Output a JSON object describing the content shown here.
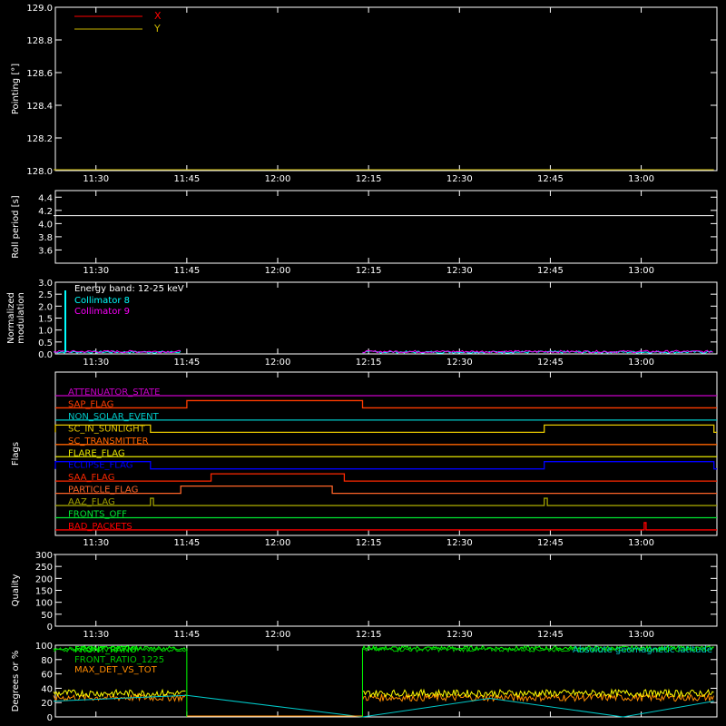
{
  "time_ticks": [
    "11:30",
    "11:45",
    "12:00",
    "12:15",
    "12:30",
    "12:45",
    "13:00"
  ],
  "chart_data": [
    {
      "type": "line",
      "panel": "pointing",
      "ylabel": "Pointing [°]",
      "ylim": [
        128.0,
        129.0
      ],
      "yticks": [
        "128.0",
        "128.2",
        "128.4",
        "128.6",
        "128.8",
        "129.0"
      ],
      "series": [
        {
          "name": "X",
          "color": "#ff0000",
          "values": []
        },
        {
          "name": "Y",
          "color": "#c8b400",
          "x": [
            "11:23",
            "13:12"
          ],
          "values": [
            128.0,
            128.0
          ]
        }
      ]
    },
    {
      "type": "line",
      "panel": "roll_period",
      "ylabel": "Roll period [s]",
      "ylim": [
        3.4,
        4.5
      ],
      "yticks": [
        "3.6",
        "3.8",
        "4.0",
        "4.2",
        "4.4"
      ],
      "series": [
        {
          "color": "#ffffff",
          "x": [
            "11:23",
            "13:12"
          ],
          "values": [
            4.12,
            4.12
          ]
        }
      ]
    },
    {
      "type": "line",
      "panel": "modulation",
      "ylabel": "Normalized modulation",
      "ylim": [
        0.0,
        3.0
      ],
      "yticks": [
        "0.0",
        "0.5",
        "1.0",
        "1.5",
        "2.0",
        "2.5",
        "3.0"
      ],
      "annotation": "Energy band: 12-25 keV",
      "series": [
        {
          "name": "Collimator 8",
          "color": "#00ffff",
          "segments": [
            [
              "11:23",
              "11:44"
            ],
            [
              "12:14",
              "13:12"
            ]
          ],
          "level": 0.03
        },
        {
          "name": "Collimator 9",
          "color": "#ff00ff",
          "segments": [
            [
              "11:23",
              "11:44"
            ],
            [
              "12:14",
              "13:12"
            ]
          ],
          "level": 0.05
        }
      ]
    },
    {
      "type": "line",
      "panel": "flags",
      "ylabel": "Flags",
      "flags": [
        {
          "name": "ATTENUATOR_STATE",
          "color": "#c800c8",
          "high": []
        },
        {
          "name": "SAP_FLAG",
          "color": "#ff3c00",
          "high": [
            [
              "11:45",
              "12:14"
            ]
          ]
        },
        {
          "name": "NON_SOLAR_EVENT",
          "color": "#00c8c8",
          "high": []
        },
        {
          "name": "SC_IN_SUNLIGHT",
          "color": "#e6c800",
          "high": [
            [
              "11:23",
              "11:39"
            ],
            [
              "12:44",
              "13:12"
            ]
          ]
        },
        {
          "name": "SC_TRANSMITTER",
          "color": "#ff6400",
          "high": []
        },
        {
          "name": "FLARE_FLAG",
          "color": "#e6e600",
          "high": []
        },
        {
          "name": "ECLIPSE_FLAG",
          "color": "#0000ff",
          "high": [
            [
              "11:23",
              "11:39"
            ],
            [
              "12:44",
              "13:12"
            ]
          ]
        },
        {
          "name": "SAA_FLAG",
          "color": "#ff2800",
          "high": [
            [
              "11:49",
              "12:11"
            ]
          ]
        },
        {
          "name": "PARTICLE_FLAG",
          "color": "#ff6428",
          "high": [
            [
              "11:44",
              "12:09"
            ]
          ]
        },
        {
          "name": "AAZ_FLAG",
          "color": "#a0a000",
          "high": [
            [
              "11:39",
              "11:39.5"
            ],
            [
              "12:44",
              "12:44.5"
            ]
          ]
        },
        {
          "name": "FRONTS_OFF",
          "color": "#00e632",
          "high": []
        },
        {
          "name": "BAD_PACKETS",
          "color": "#ff0000",
          "high": [
            [
              "13:00.5",
              "13:00.8"
            ]
          ]
        }
      ]
    },
    {
      "type": "line",
      "panel": "quality",
      "ylabel": "Quality",
      "ylim": [
        0,
        300
      ],
      "yticks": [
        "0",
        "50",
        "100",
        "150",
        "200",
        "250",
        "300"
      ],
      "series": [
        {
          "color": "#ffffff",
          "x": [
            "11:23",
            "13:12"
          ],
          "values": [
            300,
            300
          ]
        }
      ]
    },
    {
      "type": "line",
      "panel": "geomag",
      "ylabel": "Degrees or %",
      "ylim": [
        0,
        100
      ],
      "yticks": [
        "0",
        "20",
        "40",
        "60",
        "80",
        "100"
      ],
      "annotation": "Absolute geomagnetic latitude",
      "series": [
        {
          "name": "FRONT_RATIO",
          "color": "#00ff00",
          "segments": [
            [
              "11:23",
              "11:45"
            ],
            [
              "12:14",
              "13:12"
            ]
          ],
          "level": 96
        },
        {
          "name": "FRONT_RATIO_1225",
          "color": "#00c800",
          "segments": [
            [
              "11:23",
              "11:45"
            ],
            [
              "12:14",
              "13:12"
            ]
          ],
          "level": 94
        },
        {
          "name": "MAX_DET_VS_TOT",
          "color": "#ff8c00",
          "segments": [
            [
              "11:23",
              "11:45"
            ],
            [
              "12:14",
              "13:12"
            ]
          ],
          "level": 27
        },
        {
          "name": "",
          "color": "#ffff00",
          "segments": [
            [
              "11:23",
              "11:45"
            ],
            [
              "12:14",
              "13:12"
            ]
          ],
          "level": 33
        },
        {
          "name": "Absolute geomagnetic latitude",
          "color": "#00c8c8",
          "x": [
            "11:23",
            "11:45",
            "12:14",
            "12:35",
            "12:57",
            "13:12"
          ],
          "values": [
            22,
            30,
            0,
            26,
            0,
            22
          ]
        }
      ]
    }
  ]
}
